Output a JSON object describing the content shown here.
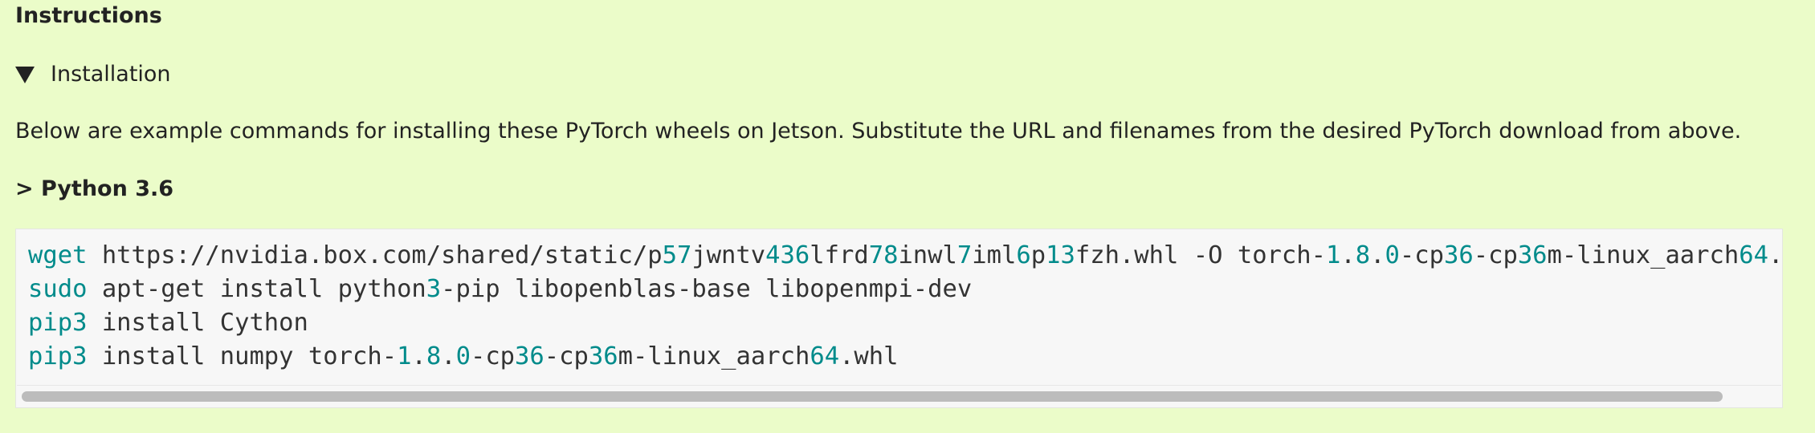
{
  "instructions_heading": "Instructions",
  "installation_toggle": {
    "label": "Installation",
    "expanded": true
  },
  "intro_text": "Below are example commands for installing these PyTorch wheels on Jetson. Substitute the URL and filenames from the desired PyTorch download from above.",
  "python_heading": "> Python 3.6",
  "code_block": {
    "lines": [
      [
        {
          "t": "cmd",
          "v": "wget"
        },
        {
          "t": "txt",
          "v": " https://nvidia.box.com/shared/static/p"
        },
        {
          "t": "num",
          "v": "57"
        },
        {
          "t": "txt",
          "v": "jwntv"
        },
        {
          "t": "num",
          "v": "436"
        },
        {
          "t": "txt",
          "v": "lfrd"
        },
        {
          "t": "num",
          "v": "78"
        },
        {
          "t": "txt",
          "v": "inwl"
        },
        {
          "t": "num",
          "v": "7"
        },
        {
          "t": "txt",
          "v": "iml"
        },
        {
          "t": "num",
          "v": "6"
        },
        {
          "t": "txt",
          "v": "p"
        },
        {
          "t": "num",
          "v": "13"
        },
        {
          "t": "txt",
          "v": "fzh.whl -O torch-"
        },
        {
          "t": "num",
          "v": "1"
        },
        {
          "t": "txt",
          "v": "."
        },
        {
          "t": "num",
          "v": "8"
        },
        {
          "t": "txt",
          "v": "."
        },
        {
          "t": "num",
          "v": "0"
        },
        {
          "t": "txt",
          "v": "-cp"
        },
        {
          "t": "num",
          "v": "36"
        },
        {
          "t": "txt",
          "v": "-cp"
        },
        {
          "t": "num",
          "v": "36"
        },
        {
          "t": "txt",
          "v": "m-linux_aarch"
        },
        {
          "t": "num",
          "v": "64"
        },
        {
          "t": "txt",
          "v": ".whl"
        }
      ],
      [
        {
          "t": "cmd",
          "v": "sudo"
        },
        {
          "t": "txt",
          "v": " apt-get install python"
        },
        {
          "t": "num",
          "v": "3"
        },
        {
          "t": "txt",
          "v": "-pip libopenblas-base libopenmpi-dev"
        }
      ],
      [
        {
          "t": "cmd",
          "v": "pip3"
        },
        {
          "t": "txt",
          "v": " install Cython"
        }
      ],
      [
        {
          "t": "cmd",
          "v": "pip3"
        },
        {
          "t": "txt",
          "v": " install numpy torch-"
        },
        {
          "t": "num",
          "v": "1"
        },
        {
          "t": "txt",
          "v": "."
        },
        {
          "t": "num",
          "v": "8"
        },
        {
          "t": "txt",
          "v": "."
        },
        {
          "t": "num",
          "v": "0"
        },
        {
          "t": "txt",
          "v": "-cp"
        },
        {
          "t": "num",
          "v": "36"
        },
        {
          "t": "txt",
          "v": "-cp"
        },
        {
          "t": "num",
          "v": "36"
        },
        {
          "t": "txt",
          "v": "m-linux_aarch"
        },
        {
          "t": "num",
          "v": "64"
        },
        {
          "t": "txt",
          "v": ".whl"
        }
      ]
    ],
    "horizontal_scroll_position": 0
  },
  "colors": {
    "page_background": "#ebfcc9",
    "code_background": "#f7f7f7",
    "code_keyword": "#008b8b",
    "text": "#222222",
    "scrollbar_thumb": "#bcbcbc"
  }
}
